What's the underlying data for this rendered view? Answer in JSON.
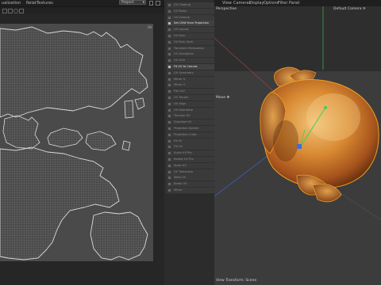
{
  "uv_editor": {
    "menu": [
      "ualization",
      "Relat",
      "Textures"
    ],
    "project_select": "Project",
    "scale_label": "UV",
    "toolbar_icons": [
      "select-icon",
      "move-icon",
      "rotate-icon",
      "scale-icon"
    ]
  },
  "tools": {
    "items": [
      {
        "label": "UV Cleanup",
        "hi": false
      },
      {
        "label": "UV Relax",
        "hi": false
      },
      {
        "label": "UV Unwrap",
        "hi": false
      },
      {
        "label": "Set UVW from Projection",
        "hi": true
      },
      {
        "label": "UV Layout",
        "hi": false
      },
      {
        "label": "UV Pack",
        "hi": false
      },
      {
        "label": "UV Pack Shell",
        "hi": false
      },
      {
        "label": "Transform Relaxation",
        "hi": false
      },
      {
        "label": "UV Straighten",
        "hi": false
      },
      {
        "label": "UV Grid",
        "hi": false
      },
      {
        "label": "Fit UV to Canvas",
        "hi": true
      },
      {
        "label": "UV Symmetry",
        "hi": false
      },
      {
        "label": "Mirror U",
        "hi": false
      },
      {
        "label": "Mirror V",
        "hi": false
      },
      {
        "label": "Flip U/V",
        "hi": false
      },
      {
        "label": "UV Terrain",
        "hi": false
      },
      {
        "label": "UV Align",
        "hi": false
      },
      {
        "label": "UV Distribute",
        "hi": false
      },
      {
        "label": "Transfer UV",
        "hi": false
      },
      {
        "label": "Quantize UV",
        "hi": false
      },
      {
        "label": "Projection Sphere",
        "hi": false
      },
      {
        "label": "Projection Cubic",
        "hi": false
      },
      {
        "label": "Fit UV",
        "hi": false
      },
      {
        "label": "Fill UV",
        "hi": false
      },
      {
        "label": "Scale UV Pts",
        "hi": false
      },
      {
        "label": "Rotate UV Pts",
        "hi": false
      },
      {
        "label": "Scale UV",
        "hi": false
      },
      {
        "label": "UV Telescopic",
        "hi": false
      },
      {
        "label": "Weld UV",
        "hi": false
      },
      {
        "label": "Break UV",
        "hi": false
      },
      {
        "label": "Mirror",
        "hi": false
      }
    ]
  },
  "viewport": {
    "menu": [
      "View",
      "Cameras",
      "Display",
      "Options",
      "Filter",
      "Panel"
    ],
    "label_top_left": "Perspective",
    "label_camera": "Default Camera ⟳",
    "label_move": "Move ✥",
    "label_bottom": "View Transform: Scene"
  },
  "colors": {
    "uv_wire": "#d8d8d8",
    "accent_selection": "#f0a020",
    "axis_y": "#3ecf5a",
    "axis_x": "#d04040",
    "axis_z": "#3a6ee0"
  }
}
